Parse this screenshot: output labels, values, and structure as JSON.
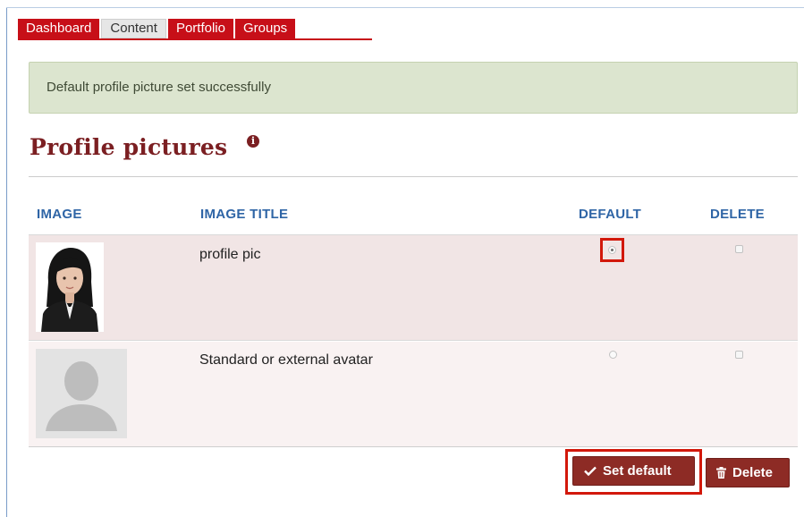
{
  "tabs": [
    {
      "label": "Dashboard"
    },
    {
      "label": "Content",
      "active": true
    },
    {
      "label": "Portfolio"
    },
    {
      "label": "Groups"
    }
  ],
  "alert": {
    "message": "Default profile picture set successfully"
  },
  "page": {
    "title": "Profile pictures",
    "info_icon": "info-circle-icon"
  },
  "table": {
    "columns": [
      "IMAGE",
      "IMAGE TITLE",
      "DEFAULT",
      "DELETE"
    ],
    "rows": [
      {
        "title": "profile pic",
        "default_selected": true,
        "delete_checked": false,
        "image": "portrait-photo"
      },
      {
        "title": "Standard or external avatar",
        "default_selected": false,
        "delete_checked": false,
        "image": "default-avatar-silhouette"
      }
    ]
  },
  "actions": {
    "set_default": "Set default",
    "delete": "Delete"
  },
  "colors": {
    "tab_red": "#c70f18",
    "heading": "#7b1f22",
    "column_header": "#2f65a6",
    "button": "#8d2b25",
    "highlight": "#d2180b",
    "alert_bg": "#dce5cf"
  }
}
